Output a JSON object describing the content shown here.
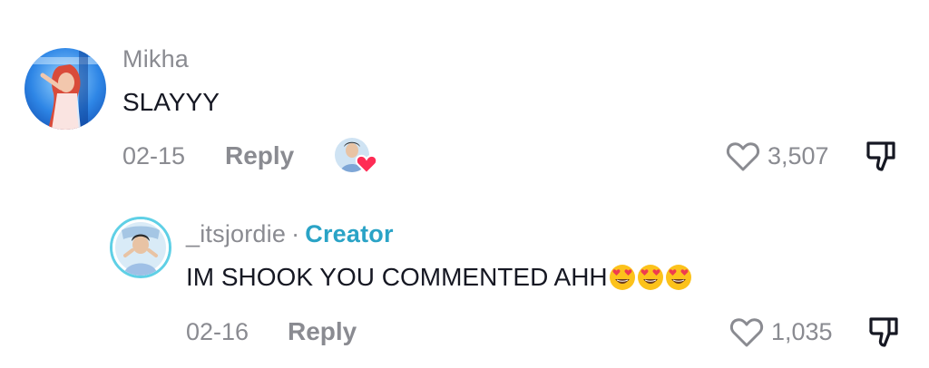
{
  "comments": [
    {
      "username": "Mikha",
      "text": "SLAYYY",
      "date": "02-15",
      "reply_label": "Reply",
      "likes": "3,507",
      "creator_liked": true
    }
  ],
  "replies": [
    {
      "username": "_itsjordie",
      "separator": "·",
      "badge": "Creator",
      "text": "IM SHOOK YOU COMMENTED AHH",
      "emoji_count": 3,
      "emoji_name": "heart-eyes-emoji",
      "date": "02-16",
      "reply_label": "Reply",
      "likes": "1,035"
    }
  ],
  "colors": {
    "muted": "#8a8b91",
    "text": "#161823",
    "creator": "#2aa3c6",
    "heart": "#fe2c55"
  }
}
